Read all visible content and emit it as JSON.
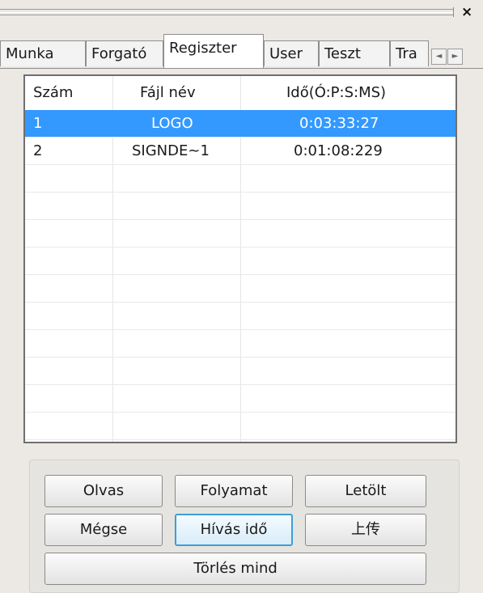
{
  "window": {
    "close_glyph": "×"
  },
  "tabs": [
    {
      "label": "Munka"
    },
    {
      "label": "Forgató"
    },
    {
      "label": "Regiszter"
    },
    {
      "label": "User"
    },
    {
      "label": "Teszt"
    },
    {
      "label": "Tra"
    }
  ],
  "tab_scroll": {
    "left": "◄",
    "right": "►"
  },
  "list": {
    "headers": {
      "num": "Szám",
      "file": "Fájl név",
      "time": "Idő(Ó:P:S:MS)"
    },
    "rows": [
      {
        "num": "1",
        "file": "LOGO",
        "time": "0:03:33:27"
      },
      {
        "num": "2",
        "file": "SIGNDE~1",
        "time": "0:01:08:229"
      }
    ],
    "selected_color": "#3399ff"
  },
  "buttons": {
    "read": "Olvas",
    "process": "Folyamat",
    "download": "Letölt",
    "cancel": "Mégse",
    "call_time": "Hívás idő",
    "upload": "上传",
    "delete_all": "Törlés mind"
  }
}
